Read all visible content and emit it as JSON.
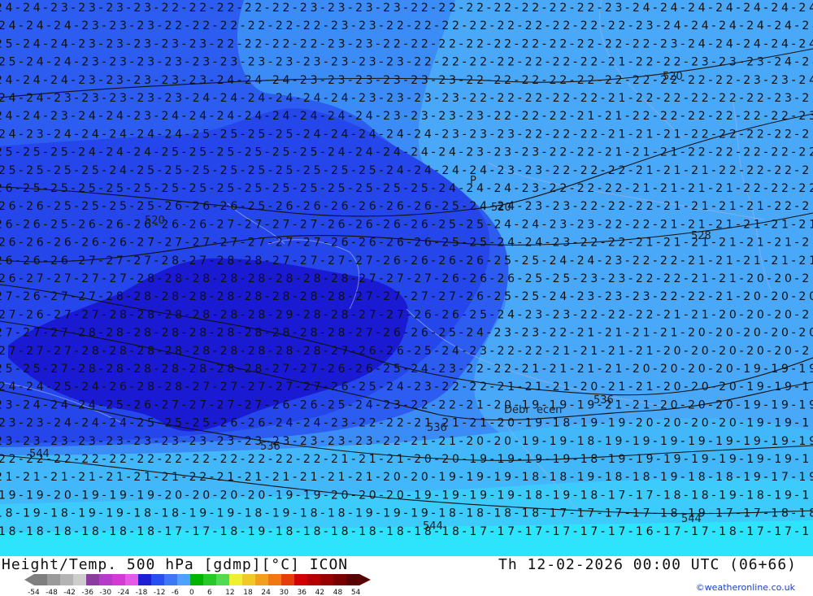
{
  "map": {
    "places": [
      {
        "name": "Debrecen",
        "label": "Debr"
      },
      {
        "name": "Debrecen-right",
        "label": "ecen"
      },
      {
        "name": "Poznan",
        "label": "P"
      }
    ],
    "contours": [
      "520",
      "520",
      "520",
      "528",
      "536",
      "536",
      "536",
      "544",
      "544",
      "544"
    ],
    "temperature_rows": [
      "24-24-23-23-23-23-22-22-22-22-22-23-23-23-23-22-22-22-22-22-22-22-23-24-24-24-24-24-24-24",
      "24-24-24-23-23-23-22-22-22-22-22-22-23-23-22-22-22-22-22-22-22-22-22-23-24-24-24-24-24-24",
      "25-24-24-23-23-23-23-23-22-22-22-22-23-23-22-22-22-22-22-22-22-22-22-22-23-24-24-24-24-24",
      "25-24-24-23-23-23-23-23-23-23-23-23-23-23-23-22-22-22-22-22-22-22-21-22-22-23-23-23-24-24",
      "24-24-24-23-23-23-23-23-24-24-24-23-23-23-23-23-23-22-22-22-22-22-22-22-22-22-22-23-23-24",
      "24-24-23-23-23-23-23-24-24-24-24-24-24-23-23-23-23-22-22-22-22-22-21-22-22-22-22-22-23-23",
      "24-24-23-24-24-23-24-24-24-24-24-24-24-24-23-23-23-23-22-22-22-21-21-22-22-22-22-22-22-23",
      "24-23-24-24-24-24-24-25-25-25-25-24-24-24-24-24-23-23-23-22-22-22-21-21-21-22-22-22-22-22",
      "25-25-25-24-24-24-25-25-25-25-25-25-24-24-24-24-24-23-23-23-22-22-21-21-21-22-22-22-22-22",
      "25-25-25-25-24-25-25-25-25-25-25-25-25-25-24-24-24-24-23-23-22-22-22-21-21-21-22-22-22-22",
      "26-25-25-25-25-25-25-25-25-25-25-25-25-25-25-25-24-24-24-23-22-22-22-21-21-21-21-22-22-22",
      "26-26-25-25-25-25-26-26-26-25-26-26-26-26-26-26-25-24-24-23-23-22-22-22-21-21-21-21-22-22",
      "26-26-25-26-26-26-26-26-27-27-27-27-26-26-26-26-25-25-24-24-23-23-22-22-21-21-21-21-21-21",
      "26-26-26-26-26-27-27-27-27-27-27-27-26-26-26-26-25-25-24-24-23-22-22-21-21-21-21-21-21-21",
      "26-26-26-27-27-27-28-27-28-28-27-27-27-27-26-26-26-26-25-25-24-24-23-22-22-21-21-21-21-21",
      "26-27-27-27-27-28-28-28-28-28-28-28-28-27-27-27-26-26-26-25-25-23-23-22-22-21-21-20-20-21",
      "27-26-27-27-28-28-28-28-28-28-28-28-28-27-27-27-27-26-25-25-24-23-23-23-22-22-21-20-20-20",
      "27-26-27-27-28-28-28-28-28-28-29-28-28-27-27-26-26-25-24-23-23-22-22-22-21-21-20-20-20-20",
      "27-27-27-28-28-28-28-28-28-28-28-28-28-27-26-26-25-24-23-23-22-21-21-21-21-20-20-20-20-20",
      "27-27-27-28-28-28-28-28-28-28-28-28-27-26-26-25-24-23-22-22-21-21-21-21-20-20-20-20-20-20",
      "25-25-27-28-28-28-28-28-28-28-27-27-26-26-25-24-23-22-22-21-21-21-21-20-20-20-20-19-19-19",
      "24-24-25-24-26-28-28-27-27-27-27-27-26-25-24-23-22-22-21-21-21-20-21-21-20-20-20-19-19-19",
      "23-24-24-24-25-26-27-27-27-27-26-26-25-24-23-22-22-21-20-19-19-19-21-21-20-20-20-19-19-19",
      "23-23-24-24-24-25-25-25-26-26-24-24-23-22-22-21-21-21-20-19-18-19-19-20-20-20-20-19-19-19",
      "23-23-23-23-23-23-23-23-23-23-23-23-23-23-22-21-21-20-20-19-19-18-19-19-19-19-19-19-19-19",
      "22-22-22-22-22-22-22-22-22-22-22-22-21-21-21-20-20-19-19-19-19-18-19-19-19-19-19-19-19-19",
      "21-21-21-21-21-21-21-22-21-21-21-21-21-21-20-20-19-19-19-18-18-19-18-18-19-18-18-19-17-19",
      "19-19-20-19-19-19-20-20-20-20-19-19-20-20-20-19-19-19-19-18-19-18-17-17-18-18-19-18-19-18",
      "18-19-18-19-19-18-18-19-19-18-19-18-18-19-19-19-18-18-18-18-17-17-17-17-18-19-17-17-18-18",
      "18-18-18-18-18-18-17-17-18-19-18-18-18-18-18-18-18-17-17-17-17-17-17-16-17-17-18-17-17-17"
    ]
  },
  "footer": {
    "title_left": "Height/Temp. 500 hPa [gdmp][°C] ICON",
    "title_right": "Th 12-02-2026 00:00 UTC (06+66)",
    "credit": "©weatheronline.co.uk",
    "legend_ticks": [
      "-54",
      "-48",
      "-42",
      "-36",
      "-30",
      "-24",
      "-18",
      "-12",
      "-6",
      "0",
      "6",
      "12",
      "18",
      "24",
      "30",
      "36",
      "42",
      "48",
      "54"
    ],
    "legend_colors": [
      "#7f7f7f",
      "#9a9a9a",
      "#b4b4b4",
      "#cdcdcd",
      "#8c3ca0",
      "#b43cc8",
      "#d23cd2",
      "#e65ae6",
      "#1e1ed2",
      "#2850f0",
      "#3c78f5",
      "#50a0ff",
      "#00b400",
      "#28c828",
      "#50dc50",
      "#f0f032",
      "#f0c828",
      "#f0a01e",
      "#f07814",
      "#e63c0a",
      "#d20000",
      "#b40000",
      "#960000",
      "#780000",
      "#5a0000"
    ]
  }
}
